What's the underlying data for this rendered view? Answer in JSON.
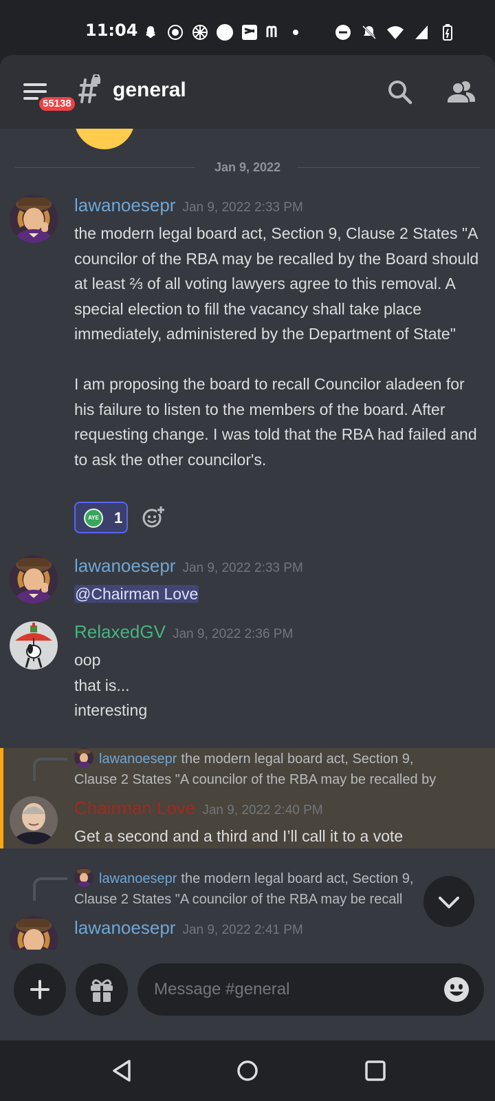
{
  "status_bar": {
    "time": "11:04"
  },
  "header": {
    "unread_badge": "55138",
    "channel_name": "general"
  },
  "date_divider": "Jan 9, 2022",
  "messages": [
    {
      "author": "lawanoesepr",
      "timestamp": "Jan 9, 2022 2:33 PM",
      "author_color": "#6fa6d6",
      "text": "the modern legal board act, Section 9, Clause 2 States \"A councilor of the RBA may be recalled by the Board should at least ⅔ of all voting lawyers agree to this removal. A special election to fill the vacancy shall take place immediately, administered by the Department of State\"\n\nI am proposing the board to recall Councilor aladeen for his failure to listen to the members of the board. After requesting change. I was told that the RBA had failed and to ask the other councilor's.",
      "reaction": {
        "emoji_label": "AYE",
        "count": "1"
      }
    },
    {
      "author": "lawanoesepr",
      "timestamp": "Jan 9, 2022 2:33 PM",
      "author_color": "#6fa6d6",
      "mention": "@Chairman Love"
    },
    {
      "author": "RelaxedGV",
      "timestamp": "Jan 9, 2022 2:36 PM",
      "author_color": "#43b581",
      "lines": [
        "oop",
        "that is...",
        "interesting"
      ]
    },
    {
      "reply_to": {
        "author": "lawanoesepr",
        "preview_line1": "the modern legal board act, Section 9,",
        "preview_line2": "Clause 2 States \"A councilor of the RBA may be recalled by"
      },
      "author": "Chairman Love",
      "timestamp": "Jan 9, 2022 2:40 PM",
      "author_color": "#a4281e",
      "text": "Get a second and a third and I’ll call it to a vote"
    },
    {
      "reply_to": {
        "author": "lawanoesepr",
        "preview_line1": "the modern legal board act, Section 9,",
        "preview_line2": "Clause 2 States \"A councilor of the RBA may be recall"
      },
      "author": "lawanoesepr",
      "timestamp": "Jan 9, 2022 2:41 PM",
      "author_color": "#6fa6d6"
    }
  ],
  "composer": {
    "placeholder": "Message #general"
  },
  "colors": {
    "accent": "#5865f2",
    "highlight_bar": "#faa61a",
    "badge": "#ed4245"
  }
}
